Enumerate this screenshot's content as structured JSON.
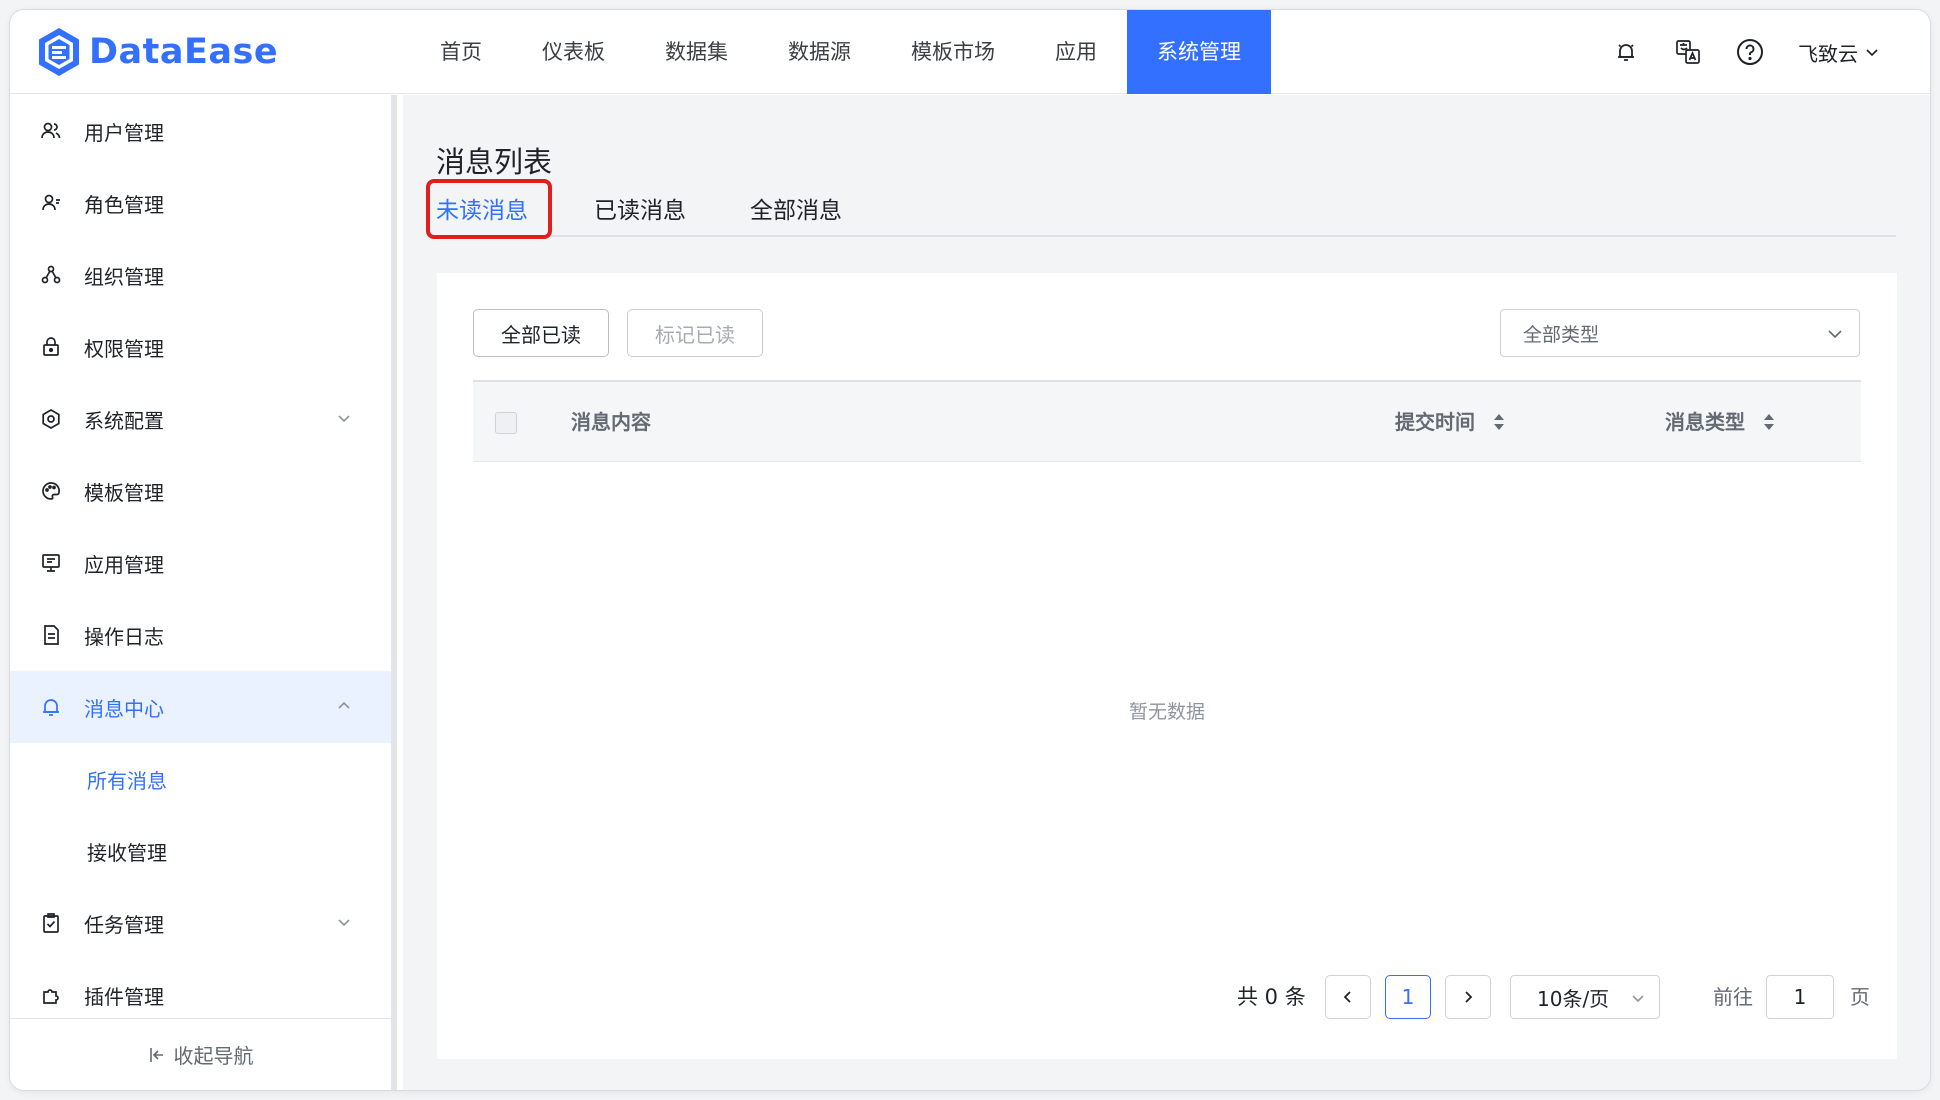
{
  "app": {
    "logo_text": "DataEase"
  },
  "nav": {
    "items": [
      "首页",
      "仪表板",
      "数据集",
      "数据源",
      "模板市场",
      "应用",
      "系统管理"
    ],
    "active": "系统管理"
  },
  "header": {
    "icons": [
      "bell-icon",
      "translate-icon",
      "help-icon"
    ],
    "user_name": "飞致云"
  },
  "sidebar": {
    "items": [
      {
        "label": "用户管理",
        "icon": "users-icon"
      },
      {
        "label": "角色管理",
        "icon": "role-icon"
      },
      {
        "label": "组织管理",
        "icon": "org-icon"
      },
      {
        "label": "权限管理",
        "icon": "lock-icon"
      },
      {
        "label": "系统配置",
        "icon": "gear-icon",
        "expandable": true
      },
      {
        "label": "模板管理",
        "icon": "palette-icon"
      },
      {
        "label": "应用管理",
        "icon": "monitor-icon"
      },
      {
        "label": "操作日志",
        "icon": "log-icon"
      },
      {
        "label": "消息中心",
        "icon": "bell-icon",
        "expandable": true,
        "open": true
      },
      {
        "label": "任务管理",
        "icon": "task-icon",
        "expandable": true
      },
      {
        "label": "插件管理",
        "icon": "plugin-icon"
      }
    ],
    "sub_items": [
      "所有消息",
      "接收管理"
    ],
    "active_sub": "所有消息",
    "collapse_label": "收起导航"
  },
  "main": {
    "title": "消息列表",
    "tabs": [
      "未读消息",
      "已读消息",
      "全部消息"
    ],
    "active_tab": "未读消息",
    "buttons": {
      "mark_all_read": "全部已读",
      "mark_read": "标记已读"
    },
    "type_filter": {
      "value": "全部类型"
    },
    "table": {
      "columns": [
        "消息内容",
        "提交时间",
        "消息类型"
      ],
      "empty_text": "暂无数据"
    },
    "pagination": {
      "total_text": "共 0 条",
      "current_page": "1",
      "page_size": "10条/页",
      "goto_label": "前往",
      "goto_value": "1",
      "page_suffix": "页"
    }
  },
  "colors": {
    "accent": "#3370ff",
    "highlight_box": "#e11d1d"
  }
}
